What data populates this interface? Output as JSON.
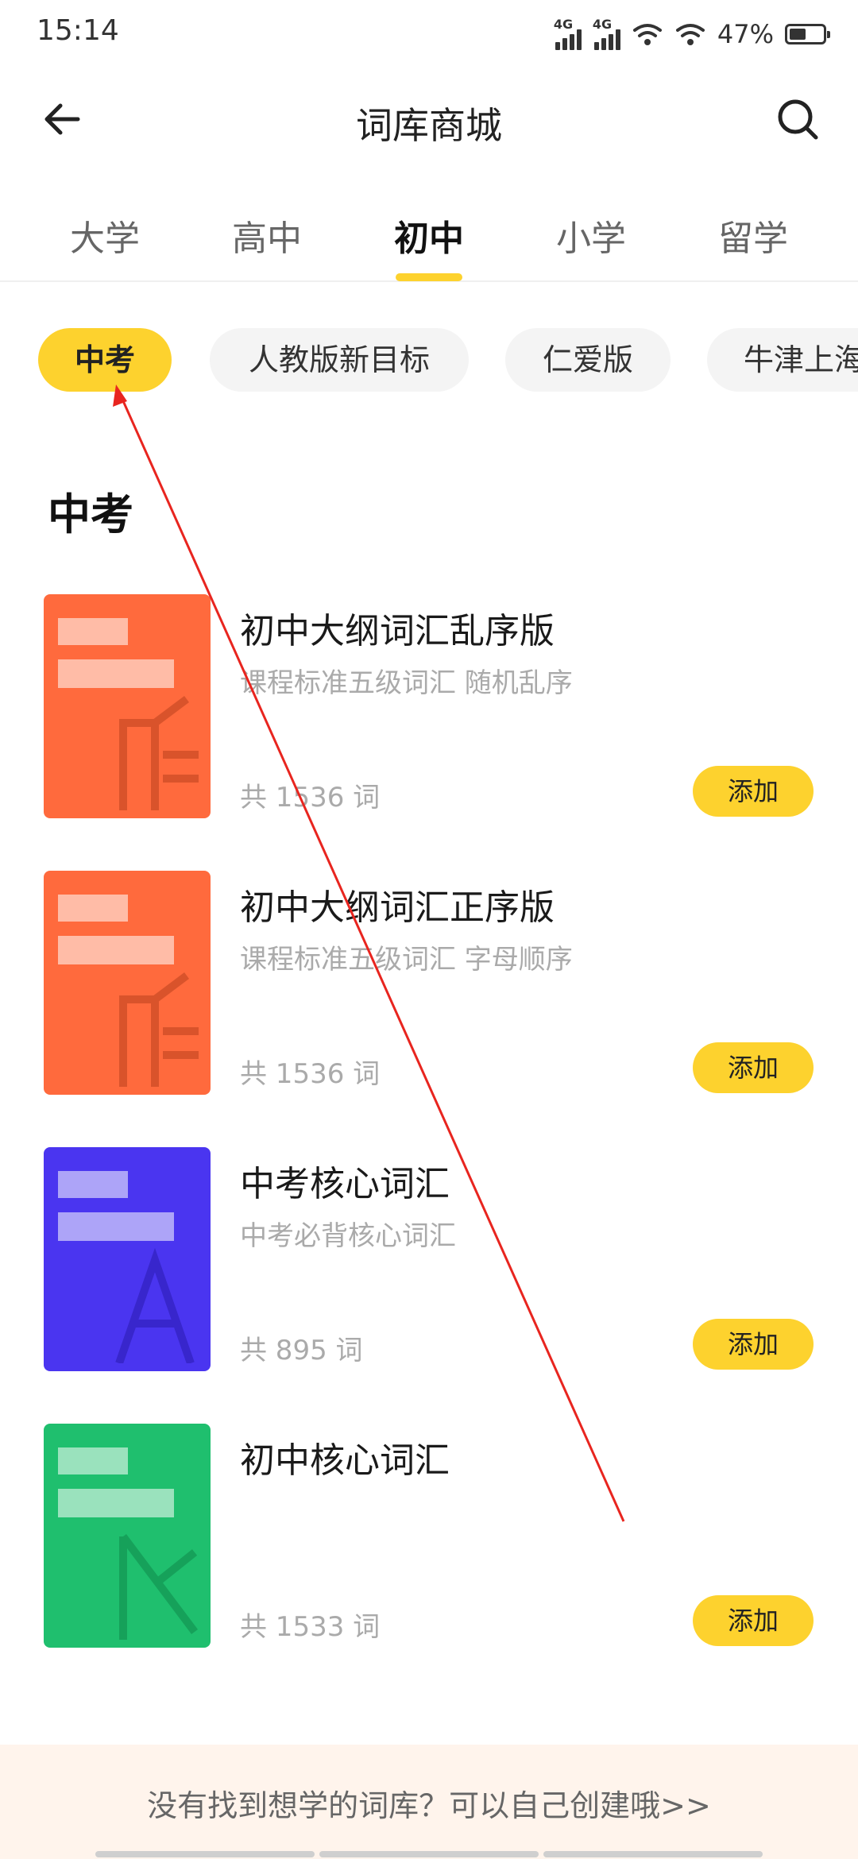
{
  "status_bar": {
    "time": "15:14",
    "net1": "4G",
    "net2": "4G",
    "battery": "47%"
  },
  "header": {
    "title": "词库商城",
    "back_icon": "back-arrow-icon",
    "search_icon": "search-icon"
  },
  "tabs": [
    {
      "label": "大学",
      "active": false
    },
    {
      "label": "高中",
      "active": false
    },
    {
      "label": "初中",
      "active": true
    },
    {
      "label": "小学",
      "active": false
    },
    {
      "label": "留学",
      "active": false
    }
  ],
  "chips": [
    {
      "label": "中考",
      "active": true
    },
    {
      "label": "人教版新目标",
      "active": false
    },
    {
      "label": "仁爱版",
      "active": false
    },
    {
      "label": "牛津上海",
      "active": false
    }
  ],
  "section_title": "中考",
  "books": [
    {
      "title": "初中大纲词汇乱序版",
      "desc": "课程标准五级词汇 随机乱序",
      "count": "共 1536 词",
      "cover_color": "#ff6a3d",
      "add_label": "添加"
    },
    {
      "title": "初中大纲词汇正序版",
      "desc": "课程标准五级词汇 字母顺序",
      "count": "共 1536 词",
      "cover_color": "#ff6a3d",
      "add_label": "添加"
    },
    {
      "title": "中考核心词汇",
      "desc": "中考必背核心词汇",
      "count": "共 895 词",
      "cover_color": "#4a35f0",
      "add_label": "添加"
    },
    {
      "title": "初中核心词汇",
      "desc": "",
      "count": "共 1533 词",
      "cover_color": "#1fbf6e",
      "add_label": "添加"
    }
  ],
  "footer": {
    "text": "没有找到想学的词库？可以自己创建哦>>"
  },
  "colors": {
    "accent": "#fdd22e",
    "annotation_arrow": "#e8251f"
  }
}
